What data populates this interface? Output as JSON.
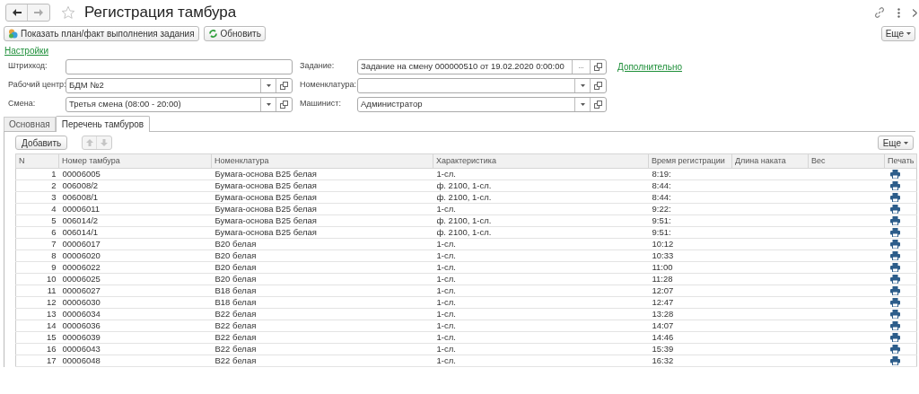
{
  "window": {
    "title": "Регистрация тамбура",
    "favorite": false
  },
  "toolbar": {
    "buttons": [
      {
        "label": "Показать план/факт выполнения задания",
        "kind": "chart"
      },
      {
        "label": "Обновить",
        "kind": "refresh"
      }
    ],
    "more": "Еще"
  },
  "settings_link": "Настройки",
  "fields_left": [
    {
      "label": "Штрихкод:",
      "kind": "text"
    },
    {
      "label": "Рабочий центр:",
      "value": "БДМ №2",
      "kind": "select"
    },
    {
      "label": "Смена:",
      "value": "Третья смена (08:00 - 20:00)",
      "kind": "select"
    }
  ],
  "fields_right": [
    {
      "label": "Задание:",
      "value": "Задание на смену 000000510 от 19.02.2020 0:00:00",
      "kind": "choice",
      "ellipsis": "..."
    },
    {
      "label": "Номенклатура:",
      "kind": "select"
    },
    {
      "label": "Машинист:",
      "value": "Администратор",
      "kind": "select"
    }
  ],
  "extra_link": "Дополнительно",
  "tabs": [
    {
      "label": "Основная",
      "selected": false
    },
    {
      "label": "Перечень тамбуров",
      "selected": true
    }
  ],
  "table_toolbar": {
    "add": "Добавить",
    "more": "Еще"
  },
  "table": {
    "columns": [
      "N",
      "Номер тамбура",
      "Номенклатура",
      "Характеристика",
      "Время регистрации",
      "Длина наката",
      "Вес",
      "Печать"
    ],
    "rows": [
      [
        "1",
        "00006005",
        "Бумага-основа B25 белая",
        "1-сл.",
        "8:19:"
      ],
      [
        "2",
        "006008/2",
        "Бумага-основа B25 белая",
        "ф. 2100, 1-сл.",
        "8:44:"
      ],
      [
        "3",
        "006008/1",
        "Бумага-основа B25 белая",
        "ф. 2100, 1-сл.",
        "8:44:"
      ],
      [
        "4",
        "00006011",
        "Бумага-основа B25 белая",
        "1-сл.",
        "9:22:"
      ],
      [
        "5",
        "006014/2",
        "Бумага-основа B25 белая",
        "ф. 2100, 1-сл.",
        "9:51:"
      ],
      [
        "6",
        "006014/1",
        "Бумага-основа B25 белая",
        "ф. 2100, 1-сл.",
        "9:51:"
      ],
      [
        "7",
        "00006017",
        "B20 белая",
        "1-сл.",
        "10:12"
      ],
      [
        "8",
        "00006020",
        "B20 белая",
        "1-сл.",
        "10:33"
      ],
      [
        "9",
        "00006022",
        "B20 белая",
        "1-сл.",
        "11:00"
      ],
      [
        "10",
        "00006025",
        "B20 белая",
        "1-сл.",
        "11:28"
      ],
      [
        "11",
        "00006027",
        "B18 белая",
        "1-сл.",
        "12:07"
      ],
      [
        "12",
        "00006030",
        "B18 белая",
        "1-сл.",
        "12:47"
      ],
      [
        "13",
        "00006034",
        "B22 белая",
        "1-сл.",
        "13:28"
      ],
      [
        "14",
        "00006036",
        "B22 белая",
        "1-сл.",
        "14:07"
      ],
      [
        "15",
        "00006039",
        "B22 белая",
        "1-сл.",
        "14:46"
      ],
      [
        "16",
        "00006043",
        "B22 белая",
        "1-сл.",
        "15:39"
      ],
      [
        "17",
        "00006048",
        "B22 белая",
        "1-сл.",
        "16:32"
      ]
    ]
  }
}
